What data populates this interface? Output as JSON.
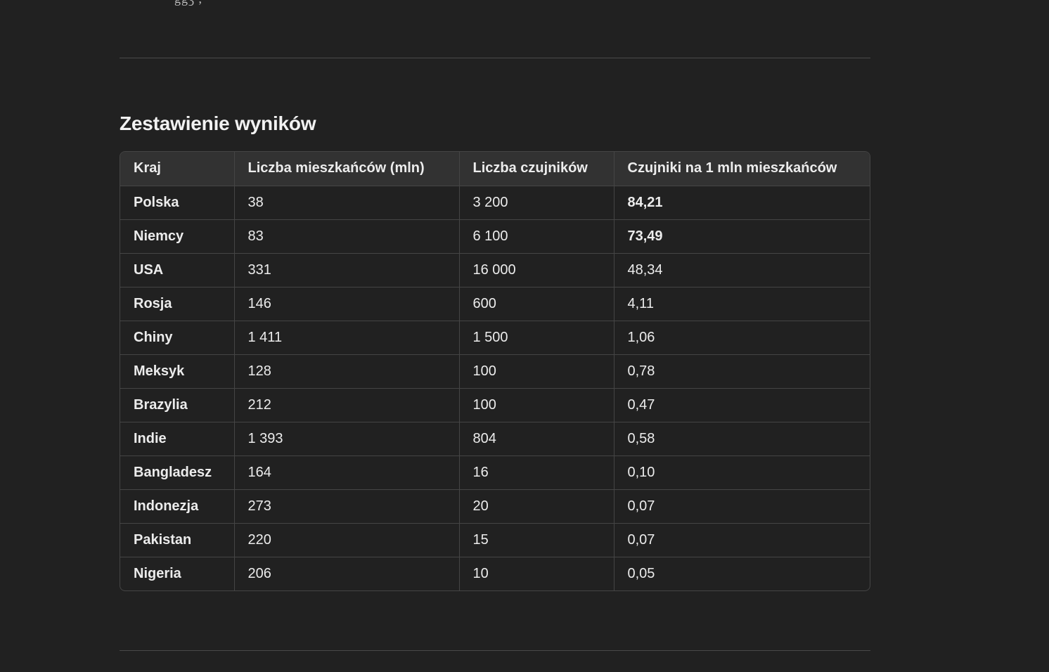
{
  "top_fragment": "ggʒ ,",
  "section_title": "Zestawienie wyników",
  "table": {
    "headers": [
      "Kraj",
      "Liczba mieszkańców (mln)",
      "Liczba czujników",
      "Czujniki na 1 mln mieszkańców"
    ],
    "rows": [
      {
        "country": "Polska",
        "population": "38",
        "sensors": "3 200",
        "per_million": "84,21"
      },
      {
        "country": "Niemcy",
        "population": "83",
        "sensors": "6 100",
        "per_million": "73,49"
      },
      {
        "country": "USA",
        "population": "331",
        "sensors": "16 000",
        "per_million": "48,34"
      },
      {
        "country": "Rosja",
        "population": "146",
        "sensors": "600",
        "per_million": "4,11"
      },
      {
        "country": "Chiny",
        "population": "1 411",
        "sensors": "1 500",
        "per_million": "1,06"
      },
      {
        "country": "Meksyk",
        "population": "128",
        "sensors": "100",
        "per_million": "0,78"
      },
      {
        "country": "Brazylia",
        "population": "212",
        "sensors": "100",
        "per_million": "0,47"
      },
      {
        "country": "Indie",
        "population": "1 393",
        "sensors": "804",
        "per_million": "0,58"
      },
      {
        "country": "Bangladesz",
        "population": "164",
        "sensors": "16",
        "per_million": "0,10"
      },
      {
        "country": "Indonezja",
        "population": "273",
        "sensors": "20",
        "per_million": "0,07"
      },
      {
        "country": "Pakistan",
        "population": "220",
        "sensors": "15",
        "per_million": "0,07"
      },
      {
        "country": "Nigeria",
        "population": "206",
        "sensors": "10",
        "per_million": "0,05"
      }
    ]
  },
  "colors": {
    "background": "#212121",
    "text": "#ececec",
    "header_bg": "#323232",
    "border": "#454545"
  }
}
